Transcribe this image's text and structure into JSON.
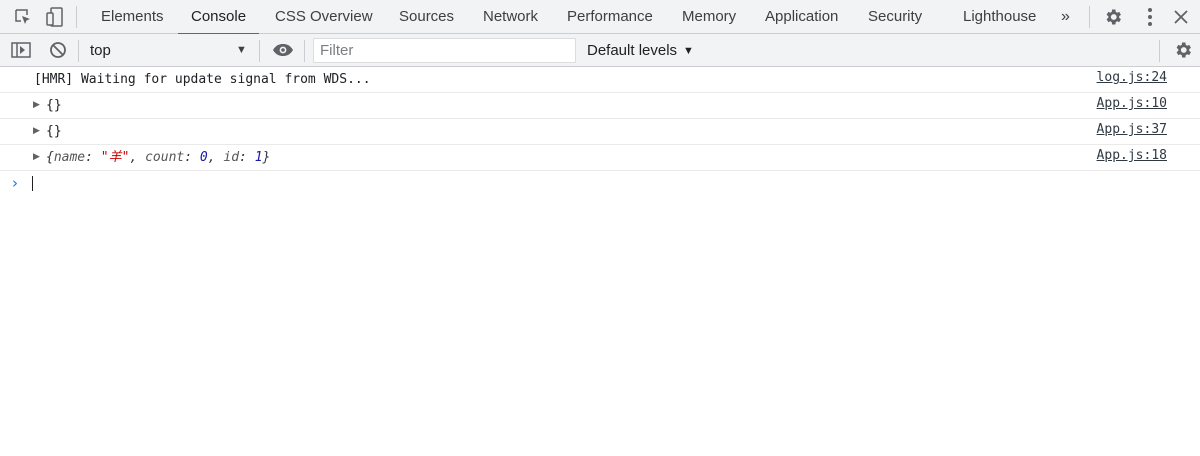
{
  "tabs": [
    {
      "label": "Elements",
      "active": false
    },
    {
      "label": "Console",
      "active": true
    },
    {
      "label": "CSS Overview",
      "active": false
    },
    {
      "label": "Sources",
      "active": false
    },
    {
      "label": "Network",
      "active": false
    },
    {
      "label": "Performance",
      "active": false
    },
    {
      "label": "Memory",
      "active": false
    },
    {
      "label": "Application",
      "active": false
    },
    {
      "label": "Security",
      "active": false
    },
    {
      "label": "Lighthouse",
      "active": false
    }
  ],
  "more_tabs": "»",
  "toolbar": {
    "context": "top",
    "context_arrow": "▼",
    "filter_placeholder": "Filter",
    "filter_value": "",
    "levels_label": "Default levels",
    "levels_arrow": "▼"
  },
  "messages": [
    {
      "text": "[HMR] Waiting for update signal from WDS...",
      "source": "log.js:24"
    },
    {
      "text": "{}",
      "source": "App.js:10",
      "expandable": true
    },
    {
      "text": "{}",
      "source": "App.js:37",
      "expandable": true
    },
    {
      "source": "App.js:18",
      "expandable": true,
      "object": {
        "open": "{",
        "key_name": "name",
        "colon": ": ",
        "value_name": "\"羊\"",
        "comma": ", ",
        "key_count": "count",
        "value_count": "0",
        "key_id": "id",
        "value_id": "1",
        "close": "}"
      }
    }
  ],
  "prompt_symbol": "›",
  "icons": {
    "inspect": "inspect-element-icon",
    "device": "device-toolbar-icon",
    "settings": "gear-icon",
    "menu": "kebab-menu-icon",
    "close": "close-icon",
    "sidebar": "console-sidebar-icon",
    "clear": "clear-console-icon",
    "eye": "live-expression-eye-icon",
    "console_settings": "console-settings-gear-icon"
  },
  "colors": {
    "accent": "#1a73e8",
    "string": "#c80000",
    "number": "#1a1aa6",
    "toolbar_bg": "#f1f3f4"
  }
}
